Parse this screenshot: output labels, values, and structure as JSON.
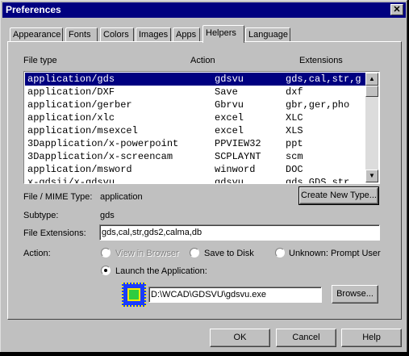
{
  "window": {
    "title": "Preferences",
    "close_glyph": "✕"
  },
  "tabs": [
    {
      "label": "Appearance"
    },
    {
      "label": "Fonts"
    },
    {
      "label": "Colors"
    },
    {
      "label": "Images"
    },
    {
      "label": "Apps"
    },
    {
      "label": "Helpers",
      "active": true
    },
    {
      "label": "Language"
    }
  ],
  "list": {
    "headers": {
      "file_type": "File type",
      "action": "Action",
      "extensions": "Extensions"
    },
    "rows": [
      {
        "type": "application/gds",
        "action": "gdsvu",
        "ext": "gds,cal,str,g",
        "selected": true
      },
      {
        "type": "application/DXF",
        "action": "Save",
        "ext": "dxf"
      },
      {
        "type": "application/gerber",
        "action": "Gbrvu",
        "ext": "gbr,ger,pho"
      },
      {
        "type": "application/xlc",
        "action": "excel",
        "ext": "XLC"
      },
      {
        "type": "application/msexcel",
        "action": "excel",
        "ext": "XLS"
      },
      {
        "type": "3Dapplication/x-powerpoint",
        "action": "PPVIEW32",
        "ext": "ppt"
      },
      {
        "type": "3Dapplication/x-screencam",
        "action": "SCPLAYNT",
        "ext": "scm"
      },
      {
        "type": "application/msword",
        "action": "winword",
        "ext": "DOC"
      },
      {
        "type": "x-gdsii/x-gdsvu",
        "action": "gdsvu",
        "ext": "gds,GDS,str"
      }
    ]
  },
  "details": {
    "mime_label": "File / MIME Type:",
    "mime_value": "application",
    "subtype_label": "Subtype:",
    "subtype_value": "gds",
    "ext_label": "File Extensions:",
    "ext_value": "gds,cal,str,gds2,calma,db",
    "create_button": "Create New Type..."
  },
  "action": {
    "label": "Action:",
    "view_in_browser": "View in Browser",
    "save_to_disk": "Save to Disk",
    "unknown": "Unknown:  Prompt User",
    "launch": "Launch the Application:",
    "app_path": "D:\\WCAD\\GDSVU\\gdsvu.exe",
    "browse_button": "Browse..."
  },
  "buttons": {
    "ok": "OK",
    "cancel": "Cancel",
    "help": "Help"
  },
  "colors": {
    "titlebar": "#000080",
    "selection": "#000080",
    "face": "#c0c0c0"
  }
}
